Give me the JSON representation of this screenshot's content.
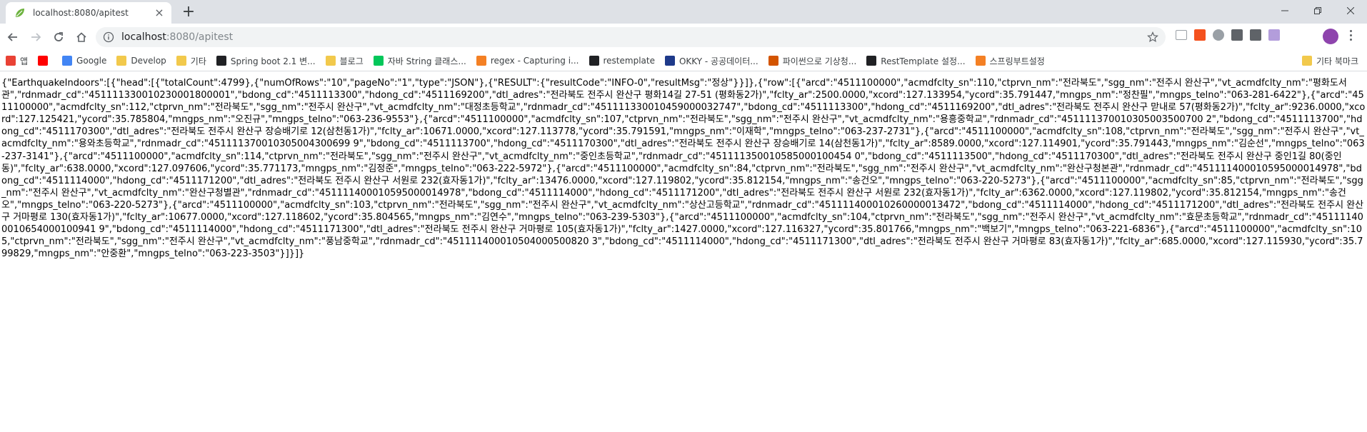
{
  "browser": {
    "tab_title": "localhost:8080/apitest",
    "tab_close_symbol": "×",
    "new_tab_symbol": "+",
    "url_host": "localhost",
    "url_path": ":8080/apitest",
    "accent_color": "#8e44ad"
  },
  "bookmarks": {
    "items": [
      {
        "label": "앱",
        "icon": "apps-grid-icon",
        "color": "#e94235"
      },
      {
        "label": "",
        "icon": "youtube-icon",
        "color": "#ff0000"
      },
      {
        "label": "Google",
        "icon": "google-icon",
        "color": "#4285f4"
      },
      {
        "label": "Develop",
        "icon": "folder-icon",
        "color": "#f2c94c"
      },
      {
        "label": "기타",
        "icon": "folder-icon",
        "color": "#f2c94c"
      },
      {
        "label": "Spring boot 2.1 변...",
        "icon": "github-icon",
        "color": "#202124"
      },
      {
        "label": "블로그",
        "icon": "folder-icon",
        "color": "#f2c94c"
      },
      {
        "label": "자바 String 클래스...",
        "icon": "naver-icon",
        "color": "#03c75a"
      },
      {
        "label": "regex - Capturing i...",
        "icon": "stackoverflow-icon",
        "color": "#f48024"
      },
      {
        "label": "restemplate",
        "icon": "dots-icon",
        "color": "#202124"
      },
      {
        "label": "OKKY - 공공데이터...",
        "icon": "okky-icon",
        "color": "#1e3a8a"
      },
      {
        "label": "파이썬으로 기상청...",
        "icon": "blog-icon",
        "color": "#d35400"
      },
      {
        "label": "RestTemplate 설정...",
        "icon": "dots-icon",
        "color": "#202124"
      },
      {
        "label": "스프링부트설정",
        "icon": "stackoverflow-icon",
        "color": "#f48024"
      }
    ],
    "other_label": "기타 북마크"
  },
  "page": {
    "json_text": "{\"EarthquakeIndoors\":[{\"head\":[{\"totalCount\":4799},{\"numOfRows\":\"10\",\"pageNo\":\"1\",\"type\":\"JSON\"},{\"RESULT\":{\"resultCode\":\"INFO-0\",\"resultMsg\":\"정상\"}}]},{\"row\":[{\"arcd\":\"4511100000\",\"acmdfclty_sn\":110,\"ctprvn_nm\":\"전라북도\",\"sgg_nm\":\"전주시 완산구\",\"vt_acmdfclty_nm\":\"평화도서관\",\"rdnmadr_cd\":\"451111330010230001800001\",\"bdong_cd\":\"4511113300\",\"hdong_cd\":\"4511169200\",\"dtl_adres\":\"전라북도 전주시 완산구 평화14길 27-51 (평화동2가)\",\"fclty_ar\":2500.0000,\"xcord\":127.133954,\"ycord\":35.791447,\"mngps_nm\":\"정찬필\",\"mngps_telno\":\"063-281-6422\"},{\"arcd\":\"4511100000\",\"acmdfclty_sn\":112,\"ctprvn_nm\":\"전라북도\",\"sgg_nm\":\"전주시 완산구\",\"vt_acmdfclty_nm\":\"대정초등학교\",\"rdnmadr_cd\":\"451111330010459000032747\",\"bdong_cd\":\"4511113300\",\"hdong_cd\":\"4511169200\",\"dtl_adres\":\"전라북도 전주시 완산구 맏내로 57(평화동2가)\",\"fclty_ar\":9236.0000,\"xcord\":127.125421,\"ycord\":35.785804,\"mngps_nm\":\"오진규\",\"mngps_telno\":\"063-236-9553\"},{\"arcd\":\"4511100000\",\"acmdfclty_sn\":107,\"ctprvn_nm\":\"전라북도\",\"sgg_nm\":\"전주시 완산구\",\"vt_acmdfclty_nm\":\"용흥중학교\",\"rdnmadr_cd\":\"451111370010305003500700 2\",\"bdong_cd\":\"4511113700\",\"hdong_cd\":\"4511170300\",\"dtl_adres\":\"전라북도 전주시 완산구 장승배기로 12(삼천동1가)\",\"fclty_ar\":10671.0000,\"xcord\":127.113778,\"ycord\":35.791591,\"mngps_nm\":\"이재학\",\"mngps_telno\":\"063-237-2731\"},{\"arcd\":\"4511100000\",\"acmdfclty_sn\":108,\"ctprvn_nm\":\"전라북도\",\"sgg_nm\":\"전주시 완산구\",\"vt_acmdfclty_nm\":\"용와초등학교\",\"rdnmadr_cd\":\"451111370010305004300699 9\",\"bdong_cd\":\"4511113700\",\"hdong_cd\":\"4511170300\",\"dtl_adres\":\"전라북도 전주시 완산구 장승배기로 14(삼천동1가)\",\"fclty_ar\":8589.0000,\"xcord\":127.114901,\"ycord\":35.791443,\"mngps_nm\":\"김순선\",\"mngps_telno\":\"063-237-3141\"},{\"arcd\":\"4511100000\",\"acmdfclty_sn\":114,\"ctprvn_nm\":\"전라북도\",\"sgg_nm\":\"전주시 완산구\",\"vt_acmdfclty_nm\":\"중인초등학교\",\"rdnmadr_cd\":\"451111350010585000100454 0\",\"bdong_cd\":\"4511113500\",\"hdong_cd\":\"4511170300\",\"dtl_adres\":\"전라북도 전주시 완산구 중인1길 80(중인동)\",\"fclty_ar\":638.0000,\"xcord\":127.097606,\"ycord\":35.771173,\"mngps_nm\":\"김정준\",\"mngps_telno\":\"063-222-5972\"},{\"arcd\":\"4511100000\",\"acmdfclty_sn\":84,\"ctprvn_nm\":\"전라북도\",\"sgg_nm\":\"전주시 완산구\",\"vt_acmdfclty_nm\":\"완산구청본관\",\"rdnmadr_cd\":\"451111400010595000014978\",\"bdong_cd\":\"4511114000\",\"hdong_cd\":\"4511171200\",\"dtl_adres\":\"전라북도 전주시 완산구 서원로 232(효자동1가)\",\"fclty_ar\":13476.0000,\"xcord\":127.119802,\"ycord\":35.812154,\"mngps_nm\":\"송건오\",\"mngps_telno\":\"063-220-5273\"},{\"arcd\":\"4511100000\",\"acmdfclty_sn\":85,\"ctprvn_nm\":\"전라북도\",\"sgg_nm\":\"전주시 완산구\",\"vt_acmdfclty_nm\":\"완산구청별관\",\"rdnmadr_cd\":\"451111400010595000014978\",\"bdong_cd\":\"4511114000\",\"hdong_cd\":\"4511171200\",\"dtl_adres\":\"전라북도 전주시 완산구 서원로 232(효자동1가)\",\"fclty_ar\":6362.0000,\"xcord\":127.119802,\"ycord\":35.812154,\"mngps_nm\":\"송건오\",\"mngps_telno\":\"063-220-5273\"},{\"arcd\":\"4511100000\",\"acmdfclty_sn\":103,\"ctprvn_nm\":\"전라북도\",\"sgg_nm\":\"전주시 완산구\",\"vt_acmdfclty_nm\":\"상산고등학교\",\"rdnmadr_cd\":\"451111400010260000013472\",\"bdong_cd\":\"4511114000\",\"hdong_cd\":\"4511171200\",\"dtl_adres\":\"전라북도 전주시 완산구 거마평로 130(효자동1가)\",\"fclty_ar\":10677.0000,\"xcord\":127.118602,\"ycord\":35.804565,\"mngps_nm\":\"김연수\",\"mngps_telno\":\"063-239-5303\"},{\"arcd\":\"4511100000\",\"acmdfclty_sn\":104,\"ctprvn_nm\":\"전라북도\",\"sgg_nm\":\"전주시 완산구\",\"vt_acmdfclty_nm\":\"효문초등학교\",\"rdnmadr_cd\":\"451111400010654000100941 9\",\"bdong_cd\":\"4511114000\",\"hdong_cd\":\"4511171300\",\"dtl_adres\":\"전라북도 전주시 완산구 거마평로 105(효자동1가)\",\"fclty_ar\":1427.0000,\"xcord\":127.116327,\"ycord\":35.801766,\"mngps_nm\":\"백보기\",\"mngps_telno\":\"063-221-6836\"},{\"arcd\":\"4511100000\",\"acmdfclty_sn\":105,\"ctprvn_nm\":\"전라북도\",\"sgg_nm\":\"전주시 완산구\",\"vt_acmdfclty_nm\":\"풍남중학교\",\"rdnmadr_cd\":\"451111400010504000500820 3\",\"bdong_cd\":\"4511114000\",\"hdong_cd\":\"4511171300\",\"dtl_adres\":\"전라북도 전주시 완산구 거마평로 83(효자동1가)\",\"fclty_ar\":685.0000,\"xcord\":127.115930,\"ycord\":35.799829,\"mngps_nm\":\"안중환\",\"mngps_telno\":\"063-223-3503\"}]}]}"
  }
}
